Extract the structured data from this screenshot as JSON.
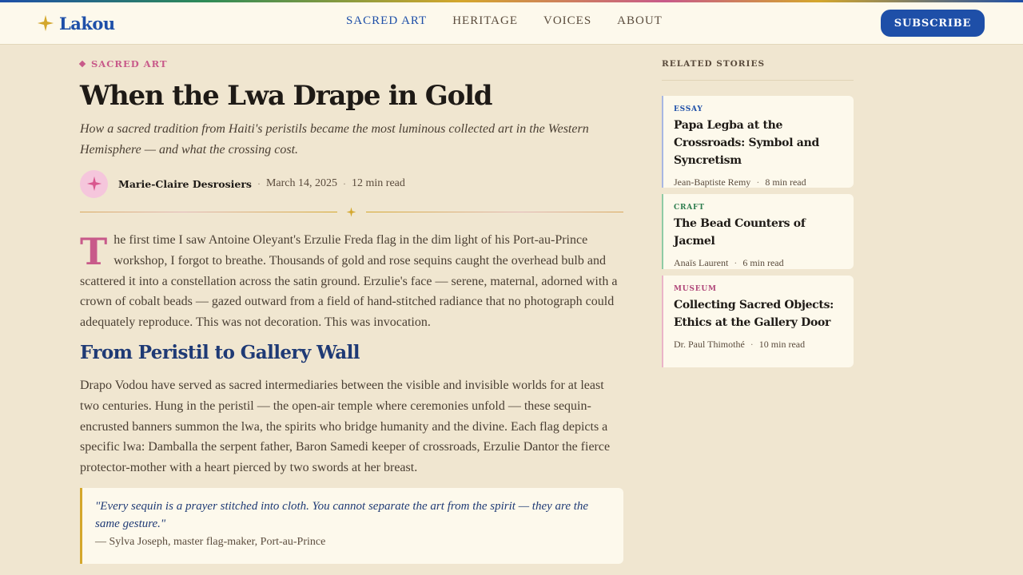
{
  "site": {
    "name": "Lakou"
  },
  "nav": {
    "items": [
      {
        "label": "SACRED ART",
        "active": true
      },
      {
        "label": "HERITAGE"
      },
      {
        "label": "VOICES"
      },
      {
        "label": "ABOUT"
      }
    ],
    "subscribe_label": "SUBSCRIBE"
  },
  "article": {
    "kicker": "SACRED ART",
    "title": "When the Lwa Drape in Gold",
    "dek": "How a sacred tradition from Haiti's peristils became the most luminous collected art in the Western Hemisphere — and what the crossing cost.",
    "author": "Marie-Claire Desrosiers",
    "date": "March 14, 2025",
    "read_time": "12 min read",
    "dropcap": "T",
    "para1": "he first time I saw Antoine Oleyant's Erzulie Freda flag in the dim light of his Port-au-Prince workshop, I forgot to breathe. Thousands of gold and rose sequins caught the overhead bulb and scattered it into a constellation across the satin ground. Erzulie's face — serene, maternal, adorned with a crown of cobalt beads — gazed outward from a field of hand-stitched radiance that no photograph could adequately reproduce. This was not decoration. This was invocation.",
    "heading": "From Peristil to Gallery Wall",
    "para2": "Drapo Vodou have served as sacred intermediaries between the visible and invisible worlds for at least two centuries. Hung in the peristil — the open-air temple where ceremonies unfold — these sequin-encrusted banners summon the lwa, the spirits who bridge humanity and the divine. Each flag depicts a specific lwa: Damballa the serpent father, Baron Samedi keeper of crossroads, Erzulie Dantor the fierce protector-mother with a heart pierced by two swords at her breast.",
    "quote": "\"Every sequin is a prayer stitched into cloth. You cannot separate the art from the spirit — they are the same gesture.\"",
    "quote_attribution": "— Sylva Joseph, master flag-maker, Port-au-Prince"
  },
  "sidebar": {
    "title": "RELATED STORIES",
    "stories": [
      {
        "tag": "ESSAY",
        "title": "Papa Legba at the Crossroads: Symbol and Syncretism",
        "author": "Jean-Baptiste Remy",
        "read_time": "8 min read"
      },
      {
        "tag": "CRAFT",
        "title": "The Bead Counters of Jacmel",
        "author": "Anaïs Laurent",
        "read_time": "6 min read"
      },
      {
        "tag": "MUSEUM",
        "title": "Collecting Sacred Objects: Ethics at the Gallery Door",
        "author": "Dr. Paul Thimothé",
        "read_time": "10 min read"
      }
    ]
  },
  "colors": {
    "brand_blue": "#1e4fa8",
    "accent_pink": "#c85a8a",
    "gold": "#d4a72c",
    "background": "#f0e6d0"
  },
  "icons": {
    "logo": "four-point-star-icon",
    "avatar": "four-point-star-icon",
    "divider": "four-point-star-icon"
  }
}
